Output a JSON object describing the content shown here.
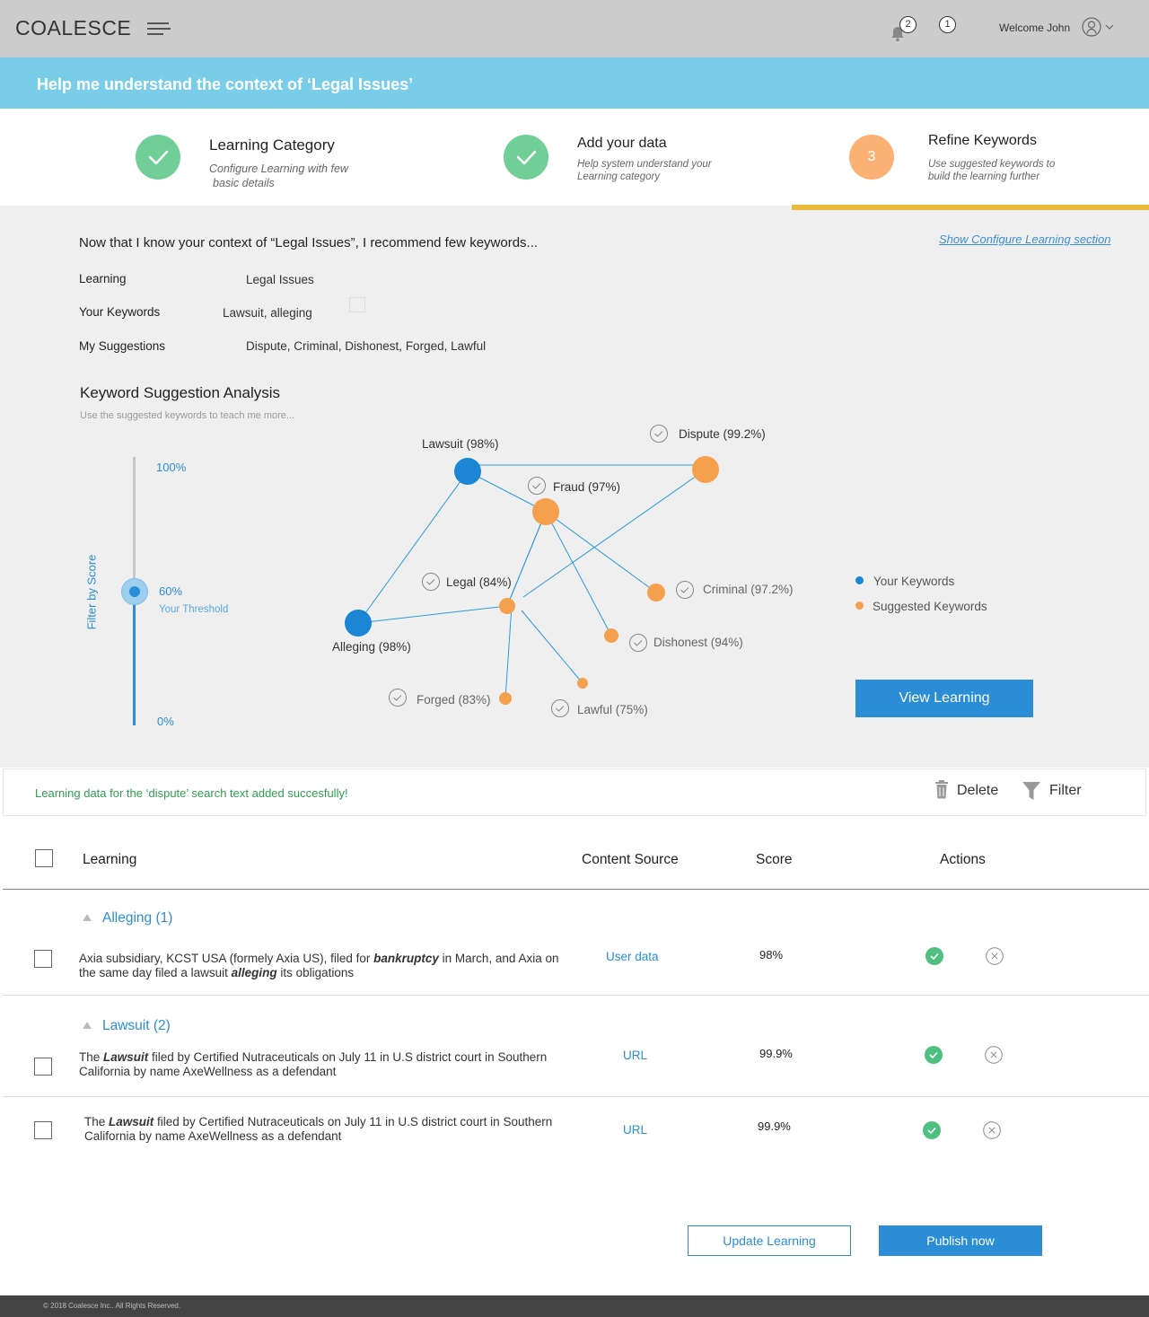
{
  "header": {
    "brand": "COALESCE",
    "notifications_count": "2",
    "messages_count": "1",
    "welcome": "Welcome John"
  },
  "banner": {
    "title": "Help me understand the context of ‘Legal Issues’"
  },
  "steps": [
    {
      "title": "Learning Category",
      "sub1": "Configure Learning with few",
      "sub2": "basic details",
      "state": "done"
    },
    {
      "title": "Add your data",
      "sub1": "Help system understand your",
      "sub2": "Learning category",
      "state": "done"
    },
    {
      "title": "Refine Keywords",
      "sub1": "Use suggested keywords to",
      "sub2": "build the learning further",
      "state": "active",
      "number": "3"
    }
  ],
  "context": {
    "intro": "Now that I know your context of “Legal Issues”, I recommend few keywords...",
    "show_link": "Show Configure Learning section",
    "learning_label": "Learning",
    "learning_value": "Legal Issues",
    "keywords_label": "Your Keywords",
    "keywords_value": "Lawsuit, alleging",
    "suggestions_label": "My Suggestions",
    "suggestions_value": "Dispute, Criminal, Dishonest, Forged, Lawful"
  },
  "analysis": {
    "title": "Keyword Suggestion Analysis",
    "subtitle": "Use the suggested keywords to teach me more...",
    "filter_label": "Filter by Score",
    "slider_max": "100%",
    "slider_value": "60%",
    "slider_value_label": "Your Threshold",
    "slider_min": "0%",
    "threshold_fraction": 0.6,
    "nodes": {
      "lawsuit": "Lawsuit (98%)",
      "dispute": "Dispute (99.2%)",
      "fraud": "Fraud (97%)",
      "legal": "Legal (84%)",
      "criminal": "Criminal (97.2%)",
      "alleging": "Alleging (98%)",
      "dishonest": "Dishonest (94%)",
      "forged": "Forged (83%)",
      "lawful": "Lawful (75%)"
    },
    "legend": {
      "yours": "Your Keywords",
      "suggested": "Suggested Keywords"
    },
    "colors": {
      "your_keyword": "#1a86d4",
      "suggested_keyword": "#f5a04c",
      "edge": "#2a9ad8"
    },
    "view_button": "View Learning"
  },
  "message_bar": {
    "message": "Learning data for the ‘dispute’ search text added succesfully!",
    "delete": "Delete",
    "filter": "Filter"
  },
  "table": {
    "headers": {
      "learning": "Learning",
      "source": "Content Source",
      "score": "Score",
      "actions": "Actions"
    },
    "groups": [
      {
        "name": "Alleging (1)",
        "rows": [
          {
            "pre": "Axia subsidiary, KCST USA (formely Axia US), filed for ",
            "bold1": "bankruptcy",
            "mid": " in March, and Axia on",
            "line2pre": "the same day filed a lawsuit ",
            "bold2": "alleging",
            "line2post": " its obligations",
            "source": "User data",
            "score": "98%"
          }
        ]
      },
      {
        "name": "Lawsuit (2)",
        "rows": [
          {
            "pre": "The ",
            "bold1": "Lawsuit",
            "mid": " filed by Certified Nutraceuticals on July 11 in U.S district court in Southern",
            "line2pre": "California by name AxeWellness as a defendant",
            "source": "URL",
            "score": "99.9%"
          },
          {
            "pre": "The ",
            "bold1": "Lawsuit",
            "mid": " filed by Certified Nutraceuticals on July 11 in U.S district court in Southern",
            "line2pre": "California by name AxeWellness as a defendant",
            "source": "URL",
            "score": "99.9%"
          }
        ]
      }
    ]
  },
  "actions": {
    "update": "Update Learning",
    "publish": "Publish now"
  },
  "footer": {
    "copyright": "© 2018 Coalesce Inc.. All Rights Reserved."
  }
}
